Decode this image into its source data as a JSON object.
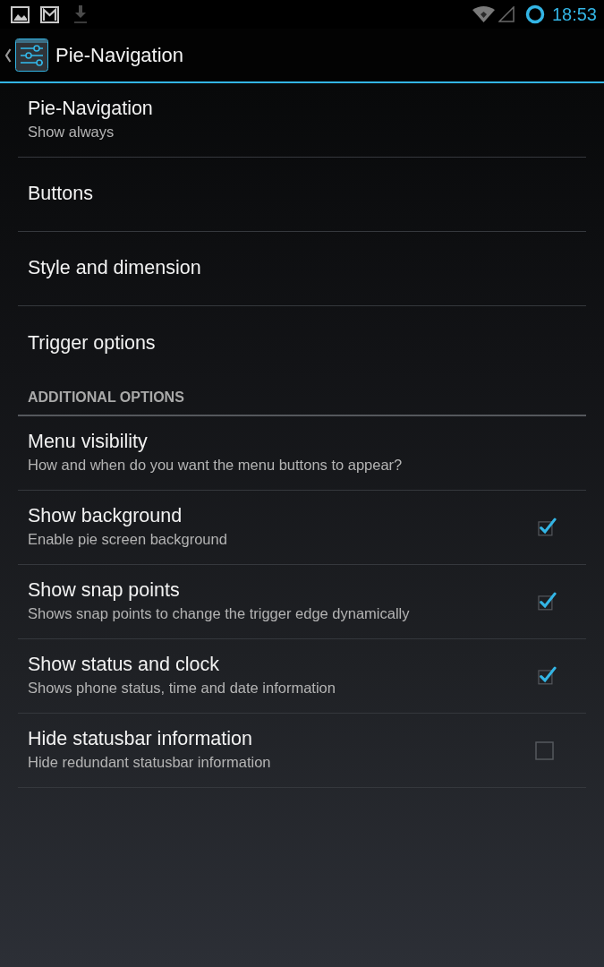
{
  "status_bar": {
    "time": "18:53"
  },
  "action_bar": {
    "title": "Pie-Navigation"
  },
  "sections": [
    {
      "items": [
        {
          "kind": "link",
          "title": "Pie-Navigation",
          "summary": "Show always"
        },
        {
          "kind": "link",
          "title": "Buttons"
        },
        {
          "kind": "link",
          "title": "Style and dimension"
        },
        {
          "kind": "link",
          "title": "Trigger options"
        }
      ]
    },
    {
      "header": "ADDITIONAL OPTIONS",
      "items": [
        {
          "kind": "link",
          "title": "Menu visibility",
          "summary": "How and when do you want the menu buttons to appear?"
        },
        {
          "kind": "checkbox",
          "title": "Show background",
          "summary": "Enable pie screen background",
          "checked": true
        },
        {
          "kind": "checkbox",
          "title": "Show snap points",
          "summary": "Shows snap points to change the trigger edge dynamically",
          "checked": true
        },
        {
          "kind": "checkbox",
          "title": "Show status and clock",
          "summary": "Shows phone status, time and date information",
          "checked": true
        },
        {
          "kind": "checkbox",
          "title": "Hide statusbar information",
          "summary": "Hide redundant statusbar information",
          "checked": false
        }
      ]
    }
  ]
}
